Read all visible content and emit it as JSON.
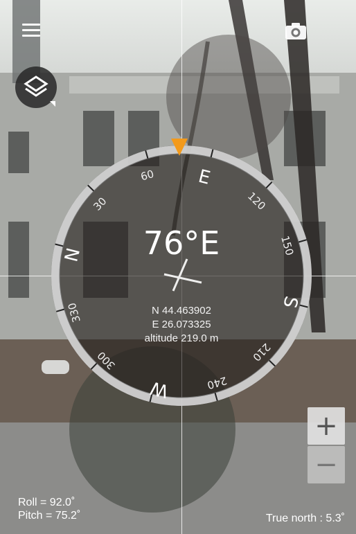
{
  "compass": {
    "heading": "76°E",
    "cardinals": {
      "N": "N",
      "E": "E",
      "S": "S",
      "W": "W"
    },
    "ticks": [
      "30",
      "60",
      "120",
      "150",
      "210",
      "240",
      "300",
      "330"
    ]
  },
  "location": {
    "latitude": "N 44.463902",
    "longitude": "E 26.073325",
    "altitude": "altitude 219.0 m"
  },
  "sensors": {
    "roll": "Roll    = 92.0˚",
    "pitch": "Pitch = 75.2˚"
  },
  "true_north": "True north : 5.3˚",
  "zoom": {
    "in": "+",
    "out": "−"
  },
  "icons": {
    "menu": "menu-icon",
    "camera": "camera-icon",
    "layers": "layers-icon"
  },
  "colors": {
    "pointer": "#f39a1b",
    "dial": "rgba(35,30,28,0.62)",
    "ring": "#d9d9d9"
  }
}
